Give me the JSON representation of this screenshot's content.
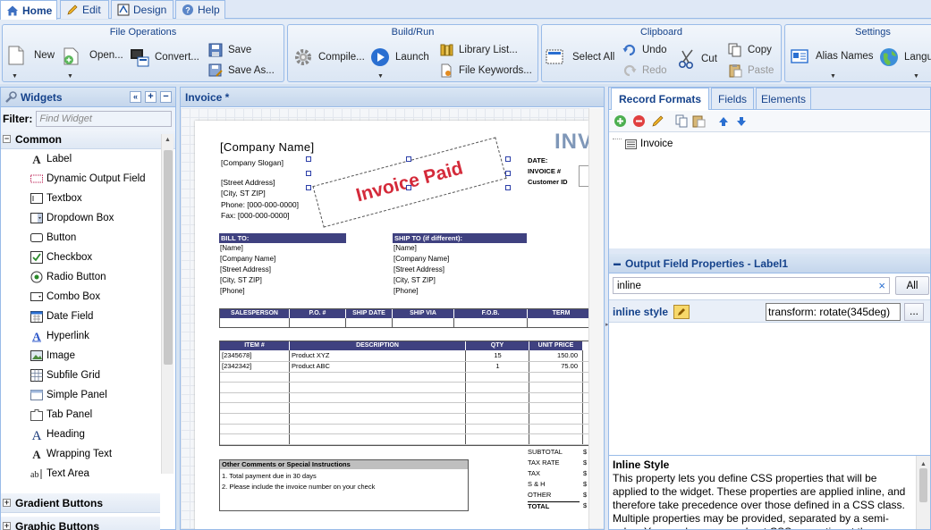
{
  "tabs": [
    {
      "label": "Home",
      "active": true
    },
    {
      "label": "Edit",
      "active": false
    },
    {
      "label": "Design",
      "active": false
    },
    {
      "label": "Help",
      "active": false
    }
  ],
  "ribbon": {
    "file_operations": {
      "title": "File Operations",
      "new": "New",
      "open": "Open...",
      "convert": "Convert...",
      "save": "Save",
      "save_as": "Save As..."
    },
    "build_run": {
      "title": "Build/Run",
      "compile": "Compile...",
      "launch": "Launch",
      "library_list": "Library List...",
      "file_keywords": "File Keywords..."
    },
    "clipboard": {
      "title": "Clipboard",
      "select_all": "Select All",
      "undo": "Undo",
      "redo": "Redo",
      "cut": "Cut",
      "copy": "Copy",
      "paste": "Paste"
    },
    "settings": {
      "title": "Settings",
      "alias_names": "Alias Names",
      "language": "Langu"
    }
  },
  "widgets_panel": {
    "title": "Widgets",
    "filter_label": "Filter:",
    "filter_placeholder": "Find Widget",
    "categories": {
      "common": "Common",
      "gradient": "Gradient Buttons",
      "graphic": "Graphic Buttons"
    },
    "items": [
      {
        "label": "Label",
        "icon": "label-icon"
      },
      {
        "label": "Dynamic Output Field",
        "icon": "dynamic-output-field-icon"
      },
      {
        "label": "Textbox",
        "icon": "textbox-icon"
      },
      {
        "label": "Dropdown Box",
        "icon": "dropdown-box-icon"
      },
      {
        "label": "Button",
        "icon": "button-icon"
      },
      {
        "label": "Checkbox",
        "icon": "checkbox-icon"
      },
      {
        "label": "Radio Button",
        "icon": "radio-button-icon"
      },
      {
        "label": "Combo Box",
        "icon": "combo-box-icon"
      },
      {
        "label": "Date Field",
        "icon": "date-field-icon"
      },
      {
        "label": "Hyperlink",
        "icon": "hyperlink-icon"
      },
      {
        "label": "Image",
        "icon": "image-icon"
      },
      {
        "label": "Subfile Grid",
        "icon": "subfile-grid-icon"
      },
      {
        "label": "Simple Panel",
        "icon": "simple-panel-icon"
      },
      {
        "label": "Tab Panel",
        "icon": "tab-panel-icon"
      },
      {
        "label": "Heading",
        "icon": "heading-icon"
      },
      {
        "label": "Wrapping Text",
        "icon": "wrapping-text-icon"
      },
      {
        "label": "Text Area",
        "icon": "text-area-icon"
      }
    ]
  },
  "editor": {
    "tab_title": "Invoice *",
    "invoice": {
      "company_name": "[Company Name]",
      "slogan": "[Company Slogan]",
      "street": "[Street Address]",
      "city": "[City, ST  ZIP]",
      "phone": "Phone: [000-000-0000]",
      "fax": "Fax: [000-000-0000]",
      "paid_stamp": "Invoice Paid",
      "title_partial": "INV",
      "date_label": "DATE:",
      "invoice_no_label": "INVOICE #",
      "customer_id_label": "Customer ID",
      "bill_to": "BILL TO:",
      "ship_to": "SHIP TO (if different):",
      "bill_lines": [
        "[Name]",
        "[Company Name]",
        "[Street Address]",
        "[City, ST  ZIP]",
        "[Phone]"
      ],
      "ship_lines": [
        "[Name]",
        "[Company Name]",
        "[Street Address]",
        "[City, ST  ZIP]",
        "[Phone]"
      ],
      "sales_headers": [
        "SALESPERSON",
        "P.O. #",
        "SHIP DATE",
        "SHIP VIA",
        "F.O.B.",
        "TERM"
      ],
      "item_headers": [
        "ITEM #",
        "DESCRIPTION",
        "QTY",
        "UNIT PRICE"
      ],
      "items": [
        {
          "item": "[2345678]",
          "desc": "Product XYZ",
          "qty": "15",
          "price": "150.00"
        },
        {
          "item": "[2342342]",
          "desc": "Product ABC",
          "qty": "1",
          "price": "75.00"
        }
      ],
      "totals": [
        "SUBTOTAL",
        "TAX RATE",
        "TAX",
        "S & H",
        "OTHER",
        "TOTAL"
      ],
      "comments_header": "Other Comments or Special Instructions",
      "comments": [
        "1. Total payment due in 30 days",
        "2. Please include the invoice number on your check"
      ]
    }
  },
  "right_panel": {
    "tabs": [
      {
        "label": "Record Formats",
        "active": true
      },
      {
        "label": "Fields",
        "active": false
      },
      {
        "label": "Elements",
        "active": false
      }
    ],
    "tree_item": "Invoice",
    "ofp_title": "Output Field Properties - Label1",
    "prop_filter_value": "inline",
    "all_button": "All",
    "prop_name": "inline style",
    "prop_value": "transform: rotate(345deg)",
    "desc_title": "Inline Style",
    "desc_text": "This property lets you define CSS properties that will be applied to the widget. These properties are applied inline, and therefore take precedence over those defined in a CSS class. Multiple properties may be provided, separated by a semi-colon. You can learn more about CSS properties at the"
  },
  "colors": {
    "accent": "#15428b",
    "stamp_red": "#d42a3a",
    "header_navy": "#3f4180"
  }
}
